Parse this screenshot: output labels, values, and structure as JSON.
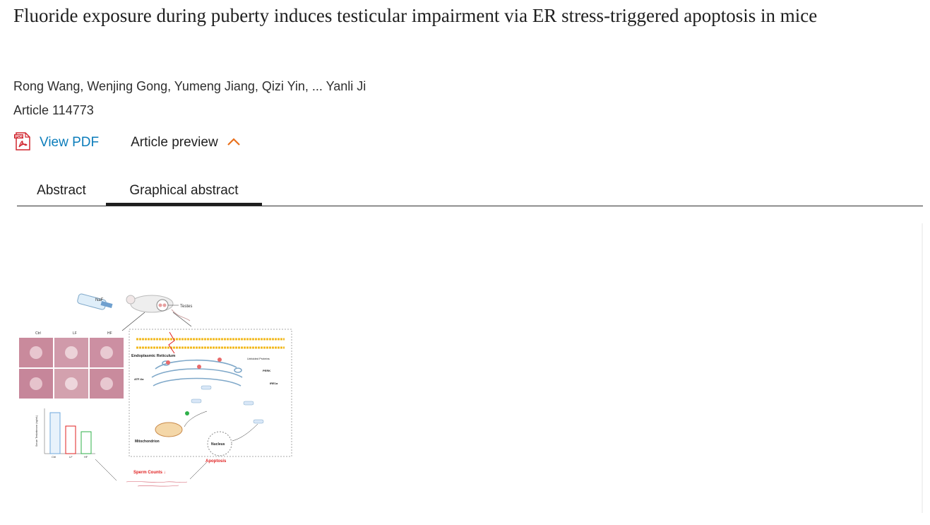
{
  "article": {
    "title": "Fluoride exposure during puberty induces testicular impairment via ER stress-triggered apoptosis in mice",
    "authors": "Rong Wang, Wenjing Gong, Yumeng Jiang, Qizi Yin, ... Yanli Ji",
    "article_number": "Article 114773"
  },
  "actions": {
    "pdf_label": "View PDF",
    "pdf_icon": "pdf-file-icon",
    "preview_label": "Article preview",
    "preview_icon": "chevron-up-icon"
  },
  "tabs": [
    {
      "label": "Abstract",
      "active": false
    },
    {
      "label": "Graphical abstract",
      "active": true
    }
  ],
  "figure": {
    "naf": "NaF",
    "testes": "Testes",
    "group_labels": [
      "Ctrl",
      "LF",
      "HF"
    ],
    "er_label": "Endoplasmic Reticulum",
    "unfolded": "Unfolded Proteins",
    "perk": "PERK",
    "ire1a": "IRE1α",
    "atf6a": "ATF-6α",
    "mito": "Mitochondrion",
    "nucleus": "Nucleus",
    "apoptosis": "Apoptosis",
    "sperm": "Sperm Counts ↓",
    "chart_ylabel": "Serum Testosterone (ng/mL)",
    "chart_values": [
      0.85,
      0.6,
      0.5
    ]
  },
  "colors": {
    "link": "#0c7dbb",
    "accent": "#e9711c",
    "pdf_red": "#d1262f",
    "figure_red": "#e02020"
  }
}
